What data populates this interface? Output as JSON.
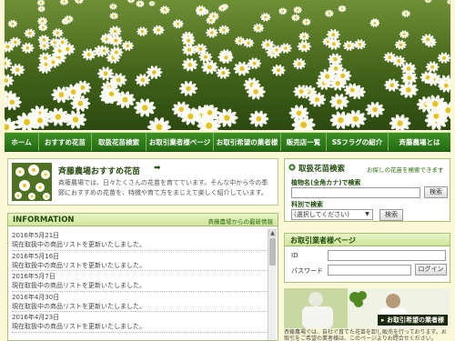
{
  "nav": {
    "items": [
      {
        "label": "ホーム"
      },
      {
        "label": "おすすめ花苗"
      },
      {
        "label": "取扱花苗検索"
      },
      {
        "label": "お取引業者様ページ"
      },
      {
        "label": "お取引希望の業者様"
      },
      {
        "label": "販売店一覧"
      },
      {
        "label": "SSフラグの紹介"
      },
      {
        "label": "斉藤農場とは"
      }
    ]
  },
  "recommend": {
    "title": "斉藤農場おすすめ花苗",
    "arrow": "➡",
    "description": "斉藤農場では、日々たくさんの花苗を育てています。そんな中から今の季節におすすめの花苗を、特徴や育て方をまじえて楽しく紹介しています。"
  },
  "info": {
    "title": "INFORMATION",
    "subtitle": "斉藤農場からの最新情報",
    "entries": [
      {
        "date": "2016年5月21日",
        "text": "現在取扱中の商品リストを更新いたしました。"
      },
      {
        "date": "2016年5月16日",
        "text": "現在取扱中の商品リストを更新いたしました。"
      },
      {
        "date": "2016年5月7日",
        "text": "現在取扱中の商品リストを更新いたしました。"
      },
      {
        "date": "2016年4月30日",
        "text": "現在取扱中の商品リストを更新いたしました。"
      },
      {
        "date": "2016年4月23日",
        "text": "現在取扱中の商品リストを更新いたしました。"
      }
    ],
    "scroll_up": "▲"
  },
  "search": {
    "title": "取扱花苗検索",
    "subtitle": "お探しの花苗を検索できます",
    "name_label": "植物名(全角カナ)で検索",
    "name_value": "",
    "name_button": "検索",
    "category_label": "科別で検索",
    "category_selected": "(選択してください)",
    "category_button": "検索"
  },
  "login": {
    "title": "お取引業者様ページ",
    "id_label": "ID",
    "id_value": "",
    "password_label": "パスワード",
    "password_value": "",
    "button": "ログイン"
  },
  "banner": {
    "label": "▸ お取引希望の業者様",
    "description": "斉藤農場では、自社で育てた花苗を卸し販売を行っております。お取引をご希望の業者様は、このページよりお問合せください。"
  },
  "colors": {
    "nav_bg": "#2f7a1e",
    "accent_green": "#1f4b0c",
    "page_bg": "#fbf8d8"
  }
}
